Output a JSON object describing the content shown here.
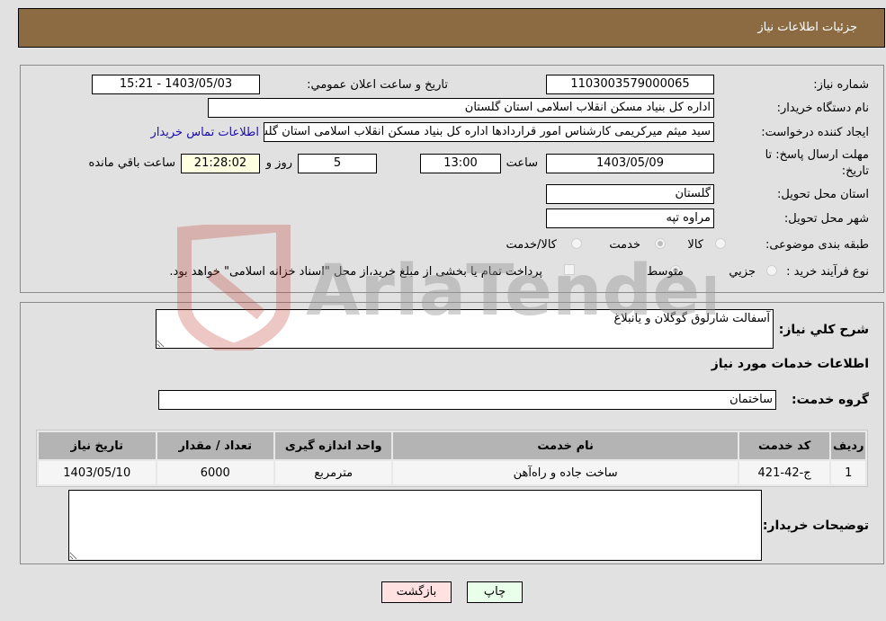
{
  "header": {
    "title": "جزئیات اطلاعات نیاز"
  },
  "details": {
    "need_number": {
      "label": "شماره نیاز:",
      "value": "1103003579000065"
    },
    "announce_datetime": {
      "label": "تاريخ و ساعت اعلان عمومي:",
      "value": "1403/05/03 - 15:21"
    },
    "buyer_org": {
      "label": "نام دستگاه خریدار:",
      "value": "اداره کل بنیاد مسکن انقلاب اسلامی استان گلستان"
    },
    "requester": {
      "label": "ایجاد کننده درخواست:",
      "value": "سید میثم میرکریمی کارشناس امور قراردادها اداره کل بنیاد مسکن انقلاب اسلامی استان گلستان",
      "contact_link": "اطلاعات تماس خریدار"
    },
    "deadline": {
      "label": "مهلت ارسال پاسخ: تا تاریخ:",
      "date": "1403/05/09",
      "time_label": "ساعت",
      "time": "13:00",
      "days": "5",
      "days_label": "روز و",
      "remaining": "21:28:02",
      "remaining_label": "ساعت باقي مانده"
    },
    "delivery_province": {
      "label": "استان محل تحویل:",
      "value": "گلستان"
    },
    "delivery_city": {
      "label": "شهر محل تحویل:",
      "value": "مراوه تپه"
    },
    "category": {
      "label": "طبقه بندی موضوعی:",
      "options": [
        "کالا",
        "خدمت",
        "کالا/خدمت"
      ],
      "selected": "خدمت"
    },
    "purchase_process": {
      "label": "نوع فرآیند خرید :",
      "options": [
        "جزيي",
        "متوسط"
      ],
      "selected": "متوسط",
      "treasury_note": "پرداخت تمام یا بخشی از مبلغ خرید،از محل \"اسناد خزانه اسلامی\" خواهد بود."
    }
  },
  "description": {
    "label": "شرح كلي نياز:",
    "value": "آسفالت شارلوق گوگلان و یانبلاغ"
  },
  "services": {
    "title": "اطلاعات خدمات مورد نياز",
    "group_label": "گروه خدمت:",
    "group_value": "ساختمان",
    "columns": [
      "ردیف",
      "کد خدمت",
      "نام خدمت",
      "واحد اندازه گیری",
      "تعداد / مقدار",
      "تاریخ نیاز"
    ],
    "rows": [
      [
        "1",
        "ج-42-421",
        "ساخت جاده و راه‌آهن",
        "مترمربع",
        "6000",
        "1403/05/10"
      ]
    ]
  },
  "buyer_notes": {
    "label": "توضیحات خریدار:",
    "value": ""
  },
  "buttons": {
    "print": "چاپ",
    "back": "بازگشت"
  },
  "watermark": {
    "text": "AriaTender.neT"
  },
  "colors": {
    "header_bg": "#8d6b42",
    "print_btn_bg": "#eaffea",
    "back_btn_bg": "#ffe1e1",
    "remaining_bg": "#ffffe1",
    "link": "#1a0dab"
  }
}
